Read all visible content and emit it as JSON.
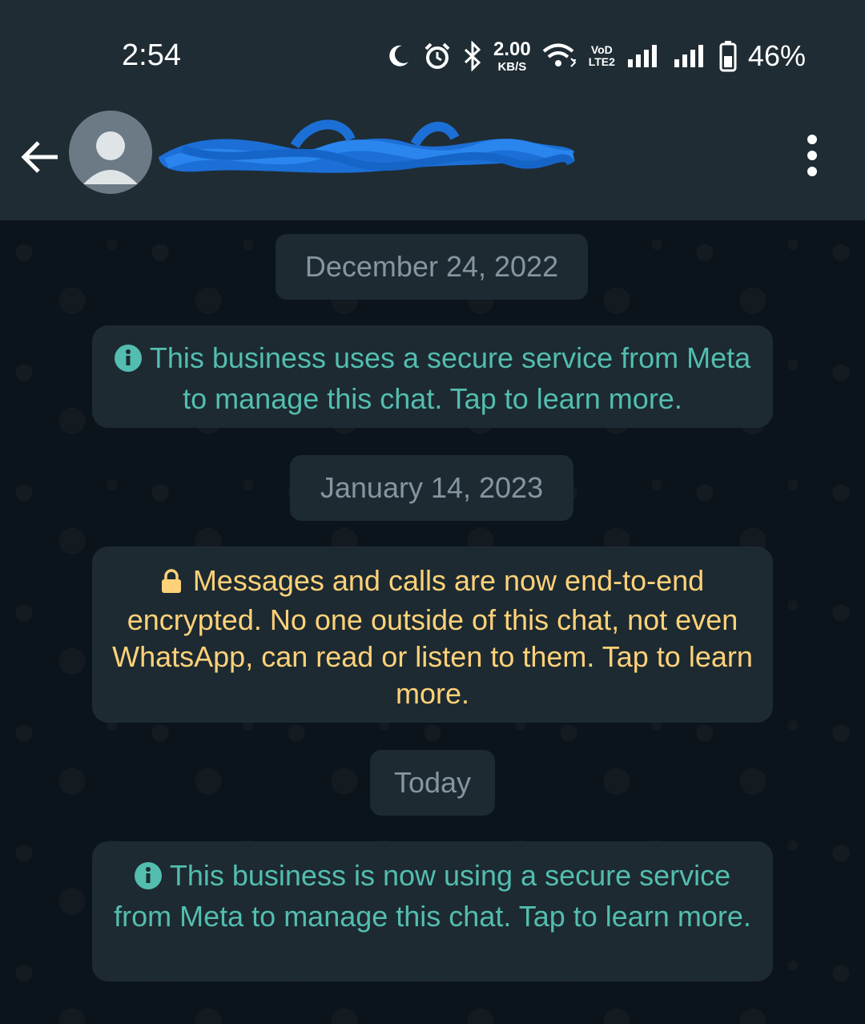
{
  "status_bar": {
    "time": "2:54",
    "net_speed_value": "2.00",
    "net_speed_unit": "KB/S",
    "volte_top": "VoD",
    "volte_bottom": "LTE2",
    "battery_percent": "46%",
    "icons": [
      "moon-icon",
      "alarm-icon",
      "bluetooth-icon",
      "wifi-icon",
      "signal-icon",
      "signal-icon",
      "battery-icon"
    ]
  },
  "header": {
    "contact_name": "",
    "icons": [
      "back-arrow-icon",
      "avatar-icon",
      "more-options-icon"
    ]
  },
  "chat": {
    "items": [
      {
        "type": "date",
        "label": "December 24, 2022"
      },
      {
        "type": "system",
        "icon": "info-icon",
        "text": "This business uses a secure service from Meta to manage this chat. Tap to learn more."
      },
      {
        "type": "date",
        "label": "January 14, 2023"
      },
      {
        "type": "system",
        "icon": "lock-icon",
        "text": "Messages and calls are now end-to-end encrypted. No one outside of this chat, not even WhatsApp, can read or listen to them. Tap to learn more."
      },
      {
        "type": "date",
        "label": "Today"
      },
      {
        "type": "system",
        "icon": "info-icon",
        "text": "This business is now using a secure service from Meta to manage this chat. Tap to learn more."
      }
    ]
  },
  "colors": {
    "bar_bg": "#1f2c34",
    "chat_bg": "#0b141a",
    "bubble_bg": "#1d2a31",
    "date_text": "#8696a0",
    "info_text": "#53bdb0",
    "encryption_text": "#ffd279"
  }
}
